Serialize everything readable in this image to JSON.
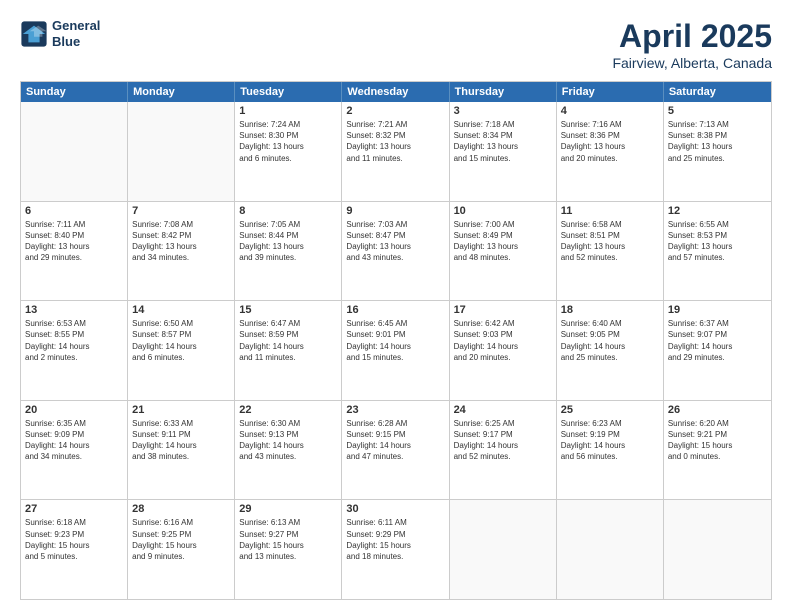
{
  "header": {
    "logo_line1": "General",
    "logo_line2": "Blue",
    "title": "April 2025",
    "subtitle": "Fairview, Alberta, Canada"
  },
  "days_of_week": [
    "Sunday",
    "Monday",
    "Tuesday",
    "Wednesday",
    "Thursday",
    "Friday",
    "Saturday"
  ],
  "weeks": [
    [
      {
        "day": "",
        "info": ""
      },
      {
        "day": "",
        "info": ""
      },
      {
        "day": "1",
        "info": "Sunrise: 7:24 AM\nSunset: 8:30 PM\nDaylight: 13 hours\nand 6 minutes."
      },
      {
        "day": "2",
        "info": "Sunrise: 7:21 AM\nSunset: 8:32 PM\nDaylight: 13 hours\nand 11 minutes."
      },
      {
        "day": "3",
        "info": "Sunrise: 7:18 AM\nSunset: 8:34 PM\nDaylight: 13 hours\nand 15 minutes."
      },
      {
        "day": "4",
        "info": "Sunrise: 7:16 AM\nSunset: 8:36 PM\nDaylight: 13 hours\nand 20 minutes."
      },
      {
        "day": "5",
        "info": "Sunrise: 7:13 AM\nSunset: 8:38 PM\nDaylight: 13 hours\nand 25 minutes."
      }
    ],
    [
      {
        "day": "6",
        "info": "Sunrise: 7:11 AM\nSunset: 8:40 PM\nDaylight: 13 hours\nand 29 minutes."
      },
      {
        "day": "7",
        "info": "Sunrise: 7:08 AM\nSunset: 8:42 PM\nDaylight: 13 hours\nand 34 minutes."
      },
      {
        "day": "8",
        "info": "Sunrise: 7:05 AM\nSunset: 8:44 PM\nDaylight: 13 hours\nand 39 minutes."
      },
      {
        "day": "9",
        "info": "Sunrise: 7:03 AM\nSunset: 8:47 PM\nDaylight: 13 hours\nand 43 minutes."
      },
      {
        "day": "10",
        "info": "Sunrise: 7:00 AM\nSunset: 8:49 PM\nDaylight: 13 hours\nand 48 minutes."
      },
      {
        "day": "11",
        "info": "Sunrise: 6:58 AM\nSunset: 8:51 PM\nDaylight: 13 hours\nand 52 minutes."
      },
      {
        "day": "12",
        "info": "Sunrise: 6:55 AM\nSunset: 8:53 PM\nDaylight: 13 hours\nand 57 minutes."
      }
    ],
    [
      {
        "day": "13",
        "info": "Sunrise: 6:53 AM\nSunset: 8:55 PM\nDaylight: 14 hours\nand 2 minutes."
      },
      {
        "day": "14",
        "info": "Sunrise: 6:50 AM\nSunset: 8:57 PM\nDaylight: 14 hours\nand 6 minutes."
      },
      {
        "day": "15",
        "info": "Sunrise: 6:47 AM\nSunset: 8:59 PM\nDaylight: 14 hours\nand 11 minutes."
      },
      {
        "day": "16",
        "info": "Sunrise: 6:45 AM\nSunset: 9:01 PM\nDaylight: 14 hours\nand 15 minutes."
      },
      {
        "day": "17",
        "info": "Sunrise: 6:42 AM\nSunset: 9:03 PM\nDaylight: 14 hours\nand 20 minutes."
      },
      {
        "day": "18",
        "info": "Sunrise: 6:40 AM\nSunset: 9:05 PM\nDaylight: 14 hours\nand 25 minutes."
      },
      {
        "day": "19",
        "info": "Sunrise: 6:37 AM\nSunset: 9:07 PM\nDaylight: 14 hours\nand 29 minutes."
      }
    ],
    [
      {
        "day": "20",
        "info": "Sunrise: 6:35 AM\nSunset: 9:09 PM\nDaylight: 14 hours\nand 34 minutes."
      },
      {
        "day": "21",
        "info": "Sunrise: 6:33 AM\nSunset: 9:11 PM\nDaylight: 14 hours\nand 38 minutes."
      },
      {
        "day": "22",
        "info": "Sunrise: 6:30 AM\nSunset: 9:13 PM\nDaylight: 14 hours\nand 43 minutes."
      },
      {
        "day": "23",
        "info": "Sunrise: 6:28 AM\nSunset: 9:15 PM\nDaylight: 14 hours\nand 47 minutes."
      },
      {
        "day": "24",
        "info": "Sunrise: 6:25 AM\nSunset: 9:17 PM\nDaylight: 14 hours\nand 52 minutes."
      },
      {
        "day": "25",
        "info": "Sunrise: 6:23 AM\nSunset: 9:19 PM\nDaylight: 14 hours\nand 56 minutes."
      },
      {
        "day": "26",
        "info": "Sunrise: 6:20 AM\nSunset: 9:21 PM\nDaylight: 15 hours\nand 0 minutes."
      }
    ],
    [
      {
        "day": "27",
        "info": "Sunrise: 6:18 AM\nSunset: 9:23 PM\nDaylight: 15 hours\nand 5 minutes."
      },
      {
        "day": "28",
        "info": "Sunrise: 6:16 AM\nSunset: 9:25 PM\nDaylight: 15 hours\nand 9 minutes."
      },
      {
        "day": "29",
        "info": "Sunrise: 6:13 AM\nSunset: 9:27 PM\nDaylight: 15 hours\nand 13 minutes."
      },
      {
        "day": "30",
        "info": "Sunrise: 6:11 AM\nSunset: 9:29 PM\nDaylight: 15 hours\nand 18 minutes."
      },
      {
        "day": "",
        "info": ""
      },
      {
        "day": "",
        "info": ""
      },
      {
        "day": "",
        "info": ""
      }
    ]
  ]
}
